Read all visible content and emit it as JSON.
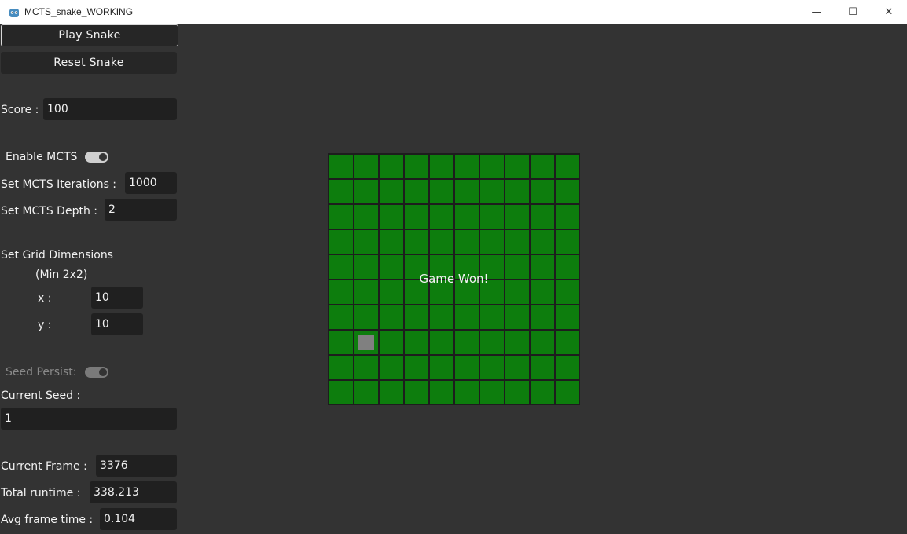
{
  "window": {
    "title": "MCTS_snake_WORKING",
    "minimize_glyph": "—",
    "maximize_glyph": "☐",
    "close_glyph": "✕"
  },
  "controls": {
    "play_label": "Play Snake",
    "reset_label": "Reset  Snake",
    "score_label": "Score :",
    "score_value": "100",
    "enable_mcts_label": "Enable MCTS",
    "enable_mcts_on": true,
    "iterations_label": "Set MCTS Iterations :",
    "iterations_value": "1000",
    "depth_label": "Set MCTS Depth :",
    "depth_value": "2",
    "grid_dims_label": "Set Grid Dimensions",
    "grid_min_label": "(Min 2x2)",
    "x_label": "x :",
    "x_value": "10",
    "y_label": "y :",
    "y_value": "10",
    "seed_persist_label": "Seed Persist:",
    "seed_persist_on": false,
    "current_seed_label": "Current Seed :",
    "current_seed_value": "1",
    "current_frame_label": "Current Frame :",
    "current_frame_value": "3376",
    "total_runtime_label": "Total runtime :",
    "total_runtime_value": "338.213",
    "avg_frame_label": "Avg frame time :",
    "avg_frame_value": "0.104"
  },
  "board": {
    "columns": 10,
    "rows": 10,
    "cell_color": "#0d7d0d",
    "food_color": "#808080",
    "food_cell": {
      "col": 1,
      "row": 7
    },
    "message": "Game Won!"
  },
  "colors": {
    "background": "#333333",
    "field_bg": "#202020",
    "button_bg": "#262626"
  }
}
